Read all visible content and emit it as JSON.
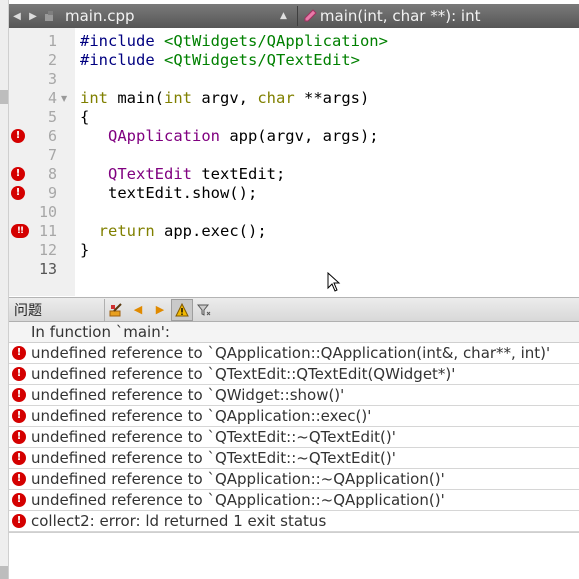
{
  "toolbar": {
    "back_icon": "arrow-left-icon",
    "forward_icon": "arrow-right-icon",
    "file_icon": "document-icon",
    "file_name": "main.cpp",
    "function_name": "main(int, char **): int"
  },
  "editor": {
    "lines": [
      {
        "num": "1"
      },
      {
        "num": "2"
      },
      {
        "num": "3"
      },
      {
        "num": "4"
      },
      {
        "num": "5"
      },
      {
        "num": "6"
      },
      {
        "num": "7"
      },
      {
        "num": "8"
      },
      {
        "num": "9"
      },
      {
        "num": "10"
      },
      {
        "num": "11"
      },
      {
        "num": "12"
      },
      {
        "num": "13"
      }
    ],
    "code": {
      "l1_pp": "#include",
      "l1_inc": "<QtWidgets/QApplication>",
      "l2_pp": "#include",
      "l2_inc": "<QtWidgets/QTextEdit>",
      "l4_kw1": "int",
      "l4_t1": " main(",
      "l4_kw2": "int",
      "l4_t2": " argv, ",
      "l4_kw3": "char",
      "l4_t3": " **args)",
      "l5": "{",
      "l6_indent": "   ",
      "l6_typ": "QApplication",
      "l6_rest": " app(argv, args);",
      "l8_indent": "   ",
      "l8_typ": "QTextEdit",
      "l8_rest": " textEdit;",
      "l9": "   textEdit.show();",
      "l11_indent": "  ",
      "l11_kw": "return",
      "l11_rest": " app.exec();",
      "l12": "}"
    }
  },
  "issues_pane": {
    "title": "问题",
    "header_row": "In function `main':",
    "issues": [
      "undefined reference to `QApplication::QApplication(int&, char**, int)'",
      "undefined reference to `QTextEdit::QTextEdit(QWidget*)'",
      "undefined reference to `QWidget::show()'",
      "undefined reference to `QApplication::exec()'",
      "undefined reference to `QTextEdit::~QTextEdit()'",
      "undefined reference to `QTextEdit::~QTextEdit()'",
      "undefined reference to `QApplication::~QApplication()'",
      "undefined reference to `QApplication::~QApplication()'",
      "collect2: error: ld returned 1 exit status"
    ]
  },
  "colors": {
    "error": "#d40000",
    "keyword": "#808000",
    "preprocessor": "#000080",
    "include_path": "#008000",
    "type": "#800080"
  }
}
